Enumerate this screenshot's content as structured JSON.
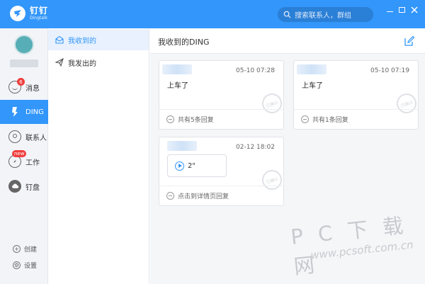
{
  "app": {
    "name_cn": "钉钉",
    "name_en": "Dingtalk",
    "brand_color": "#3296fa",
    "search_placeholder": "搜索联系人，群组",
    "window_controls": [
      "minimize",
      "maximize",
      "close"
    ]
  },
  "nav": {
    "items": [
      {
        "label": "消息",
        "icon": "chat-smile-icon",
        "badge": "6"
      },
      {
        "label": "DING",
        "icon": "ding-icon",
        "active": true
      },
      {
        "label": "联系人",
        "icon": "contacts-icon"
      },
      {
        "label": "工作",
        "icon": "compass-icon",
        "badge": "new"
      },
      {
        "label": "钉盘",
        "icon": "cloud-disk-icon"
      }
    ],
    "bottom": [
      {
        "label": "创建",
        "icon": "plus-icon"
      },
      {
        "label": "设置",
        "icon": "gear-icon"
      }
    ]
  },
  "subnav": {
    "items": [
      {
        "label": "我收到的",
        "icon": "inbox-icon",
        "active": true
      },
      {
        "label": "我发出的",
        "icon": "send-icon"
      }
    ]
  },
  "main": {
    "title": "我收到的DING",
    "cards": [
      {
        "time": "05-10 07:28",
        "message": "上车了",
        "footer": "共有5条回复"
      },
      {
        "time": "05-10 07:19",
        "message": "上车了",
        "footer": "共有1条回复"
      },
      {
        "time": "02-12 18:02",
        "voice_duration": "2\"",
        "footer": "点击到详情页回复"
      }
    ],
    "stamp_text": "已确认"
  },
  "watermark": {
    "big": "P C 下 载 网",
    "small": "www.pcsoft.com.cn"
  }
}
